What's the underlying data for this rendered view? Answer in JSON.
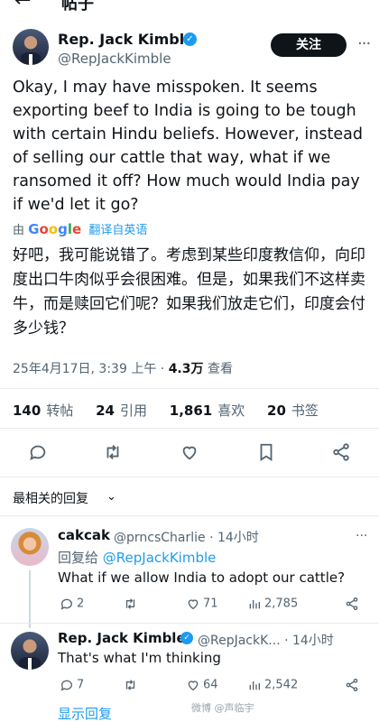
{
  "header": {
    "title": "帖子",
    "back_icon": "arrow-left-icon"
  },
  "tweet": {
    "author_name": "Rep. Jack Kimble",
    "author_handle": "@RepJackKimble",
    "follow_label": "关注",
    "more_label": "···",
    "text": "Okay, I may have misspoken.  It seems exporting beef to India is going to be tough with certain Hindu beliefs.  However, instead of selling our cattle that way, what if we ransomed it off?  How much would India pay if we'd let it go?",
    "translate_prefix": "由",
    "translate_brand": "Google",
    "translate_label": "翻译自英语",
    "translated_text": "好吧，我可能说错了。考虑到某些印度教信仰，向印度出口牛肉似乎会很困难。但是，如果我们不这样卖牛，而是赎回它们呢？如果我们放走它们，印度会付多少钱？",
    "date": "25年4月17日, 3:39 上午 · ",
    "views_count": "4.3万",
    "views_label": " 查看",
    "stats": [
      {
        "count": "140",
        "label": "转帖"
      },
      {
        "count": "24",
        "label": "引用"
      },
      {
        "count": "1,861",
        "label": "喜欢"
      },
      {
        "count": "20",
        "label": "书签"
      }
    ]
  },
  "sort": {
    "label": "最相关的回复",
    "chevron": "⌄"
  },
  "replies": [
    {
      "name": "cakcak",
      "handle": "@prncsCharlie · 14小时",
      "reply_prefix": "回复给 ",
      "reply_to": "@RepJackKimble",
      "text": "What if we allow India to adopt our cattle?",
      "replies_count": "2",
      "retweets_count": "",
      "likes_count": "71",
      "views_count": "2,785"
    },
    {
      "name": "Rep. Jack Kimble",
      "handle": "@RepJackK... · 14小时",
      "text": "That's what I'm thinking",
      "replies_count": "7",
      "retweets_count": "",
      "likes_count": "64",
      "views_count": "2,542",
      "show_replies": "显示回复"
    }
  ],
  "watermark": "微博 @声临宇",
  "colors": {
    "accent": "#1d9bf0",
    "text": "#0f1419",
    "muted": "#536471",
    "divider": "#e6ecf0"
  }
}
